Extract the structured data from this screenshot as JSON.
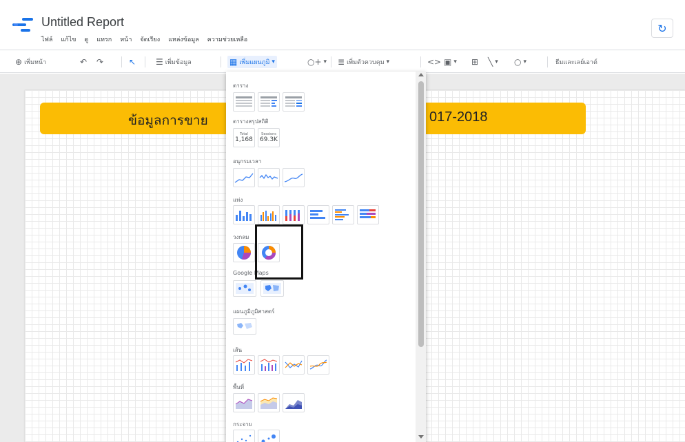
{
  "app": {
    "title": "Untitled Report",
    "accent": "#1a73e8",
    "menu": [
      "ไฟล์",
      "แก้ไข",
      "ดู",
      "แทรก",
      "หน้า",
      "จัดเรียง",
      "แหล่งข้อมูล",
      "ความช่วยเหลือ"
    ]
  },
  "toolbar": {
    "add_page": "เพิ่มหน้า",
    "add_data": "เพิ่มข้อมูล",
    "add_chart": "เพิ่มแผนภูมิ",
    "add_control": "เพิ่มตัวควบคุม",
    "theme_layout": "ธีมและเลย์เอาต์"
  },
  "report": {
    "banner_left": "ข้อมูลการขาย",
    "banner_right": "017-2018",
    "banner_color": "#fbbc04"
  },
  "chart_menu": {
    "sections": {
      "table": "ตาราง",
      "scorecard": "ตารางสรุปสถิติ",
      "timeseries": "อนุกรมเวลา",
      "bar": "แท่ง",
      "pie": "วงกลม",
      "google_maps": "Google Maps",
      "geo": "แผนภูมิภูมิศาสตร์",
      "line": "เส้น",
      "area": "พื้นที่",
      "scatter": "กระจาย"
    },
    "scorecard_values": [
      "1,168",
      "69.3K"
    ],
    "scorecard_small": [
      "Total",
      "Sessions"
    ]
  }
}
